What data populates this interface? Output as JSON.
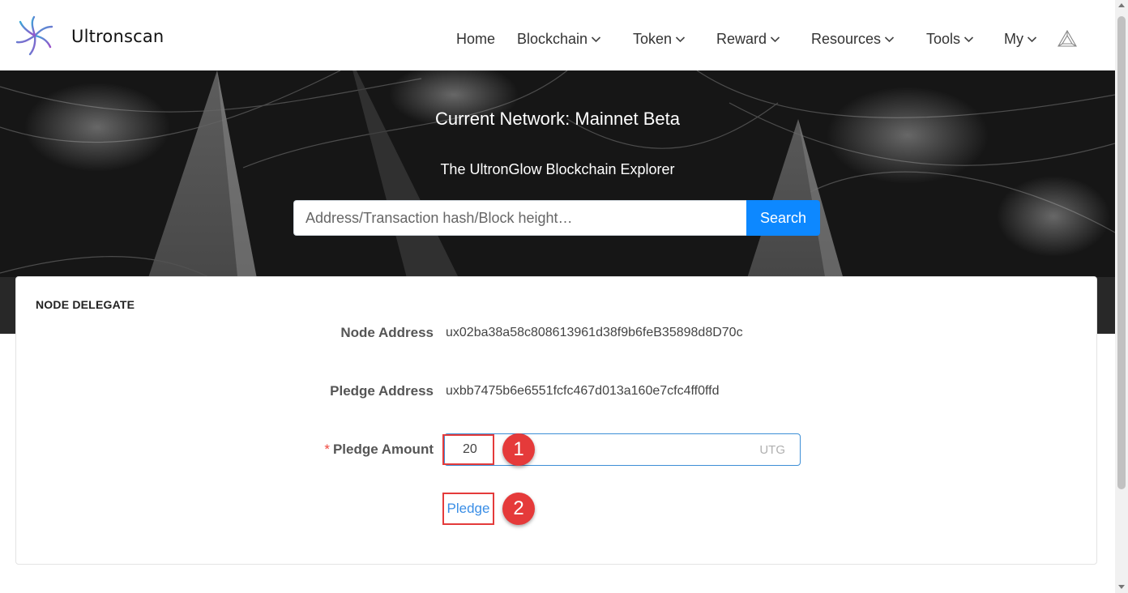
{
  "header": {
    "brand": "Ultronscan",
    "logo_icon": "star-burst-logo-icon",
    "nav": [
      {
        "label": "Home",
        "dropdown": false
      },
      {
        "label": "Blockchain",
        "dropdown": true
      },
      {
        "label": "Token",
        "dropdown": true
      },
      {
        "label": "Reward",
        "dropdown": true
      },
      {
        "label": "Resources",
        "dropdown": true
      },
      {
        "label": "Tools",
        "dropdown": true
      },
      {
        "label": "My",
        "dropdown": true
      }
    ],
    "network_icon": "triangle-network-icon"
  },
  "hero": {
    "title": "Current Network: Mainnet Beta",
    "subtitle": "The UltronGlow Blockchain Explorer",
    "search_placeholder": "Address/Transaction hash/Block height…",
    "search_button": "Search"
  },
  "delegate": {
    "title": "NODE DELEGATE",
    "node_address_label": "Node Address",
    "node_address": "ux02ba38a58c808613961d38f9b6feB35898d8D70c",
    "pledge_address_label": "Pledge Address",
    "pledge_address": "uxbb7475b6e6551fcfc467d013a160e7cfc4ff0ffd",
    "required_mark": "*",
    "pledge_amount_label": "Pledge Amount",
    "pledge_amount_value": "20",
    "unit": "UTG",
    "pledge_button": "Pledge"
  },
  "annotations": {
    "step1": "1",
    "step2": "2",
    "color": "#e53a3a"
  },
  "colors": {
    "primary": "#0d88ff",
    "link": "#3a8ee6",
    "input_border": "#3d8fd6"
  }
}
